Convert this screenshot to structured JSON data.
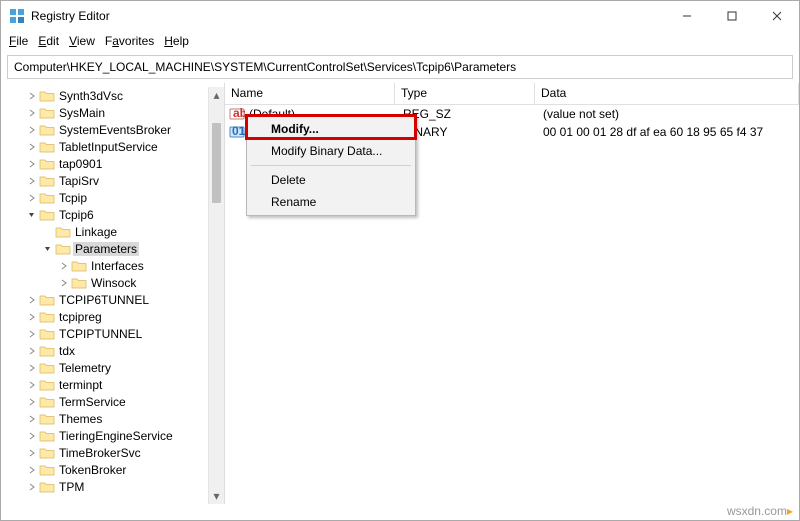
{
  "window": {
    "title": "Registry Editor"
  },
  "menu": {
    "file": "File",
    "edit": "Edit",
    "view": "View",
    "favorites": "Favorites",
    "help": "Help"
  },
  "address": "Computer\\HKEY_LOCAL_MACHINE\\SYSTEM\\CurrentControlSet\\Services\\Tcpip6\\Parameters",
  "tree": {
    "items": [
      "Synth3dVsc",
      "SysMain",
      "SystemEventsBroker",
      "TabletInputService",
      "tap0901",
      "TapiSrv",
      "Tcpip",
      "Tcpip6",
      "Linkage",
      "Parameters",
      "Interfaces",
      "Winsock",
      "TCPIP6TUNNEL",
      "tcpipreg",
      "TCPIPTUNNEL",
      "tdx",
      "Telemetry",
      "terminpt",
      "TermService",
      "Themes",
      "TieringEngineService",
      "TimeBrokerSvc",
      "TokenBroker",
      "TPM"
    ]
  },
  "list": {
    "headers": {
      "name": "Name",
      "type": "Type",
      "data": "Data"
    },
    "rows": [
      {
        "name": "(Default)",
        "type": "REG_SZ",
        "data": "(value not set)"
      },
      {
        "name": "",
        "type": "BINARY",
        "data": "00 01 00 01 28 df af ea 60 18 95 65 f4 37"
      }
    ]
  },
  "context_menu": {
    "modify": "Modify...",
    "modify_binary": "Modify Binary Data...",
    "delete": "Delete",
    "rename": "Rename"
  },
  "footer": {
    "site": "wsxdn.com"
  }
}
